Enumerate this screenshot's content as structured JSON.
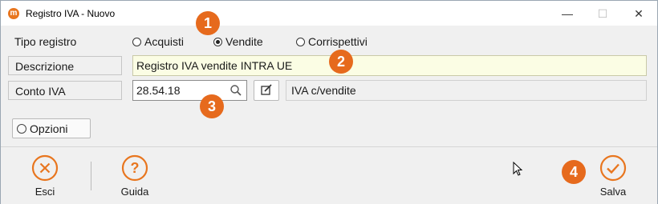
{
  "window": {
    "title": "Registro IVA - Nuovo",
    "app_icon_glyph": "m",
    "minimize_glyph": "—",
    "maximize_glyph": "☐",
    "close_glyph": "✕"
  },
  "form": {
    "tipo_registro": {
      "label": "Tipo registro",
      "options": [
        "Acquisti",
        "Vendite",
        "Corrispettivi"
      ],
      "selected": "Vendite"
    },
    "descrizione": {
      "label": "Descrizione",
      "value": "Registro IVA vendite INTRA UE"
    },
    "conto_iva": {
      "label": "Conto IVA",
      "value": "28.54.18",
      "description": "IVA c/vendite"
    },
    "opzioni_label": "Opzioni"
  },
  "footer": {
    "esci_label": "Esci",
    "guida_label": "Guida",
    "salva_label": "Salva"
  },
  "callouts": [
    "1",
    "2",
    "3",
    "4"
  ],
  "colors": {
    "accent_orange": "#e66a1d",
    "active_field": "#fbfde4",
    "panel_bg": "#f0f0f0"
  },
  "icons": {
    "esci": "close-circle-icon",
    "guida": "help-circle-icon",
    "salva": "check-circle-icon",
    "search": "search-icon",
    "edit": "edit-icon"
  }
}
